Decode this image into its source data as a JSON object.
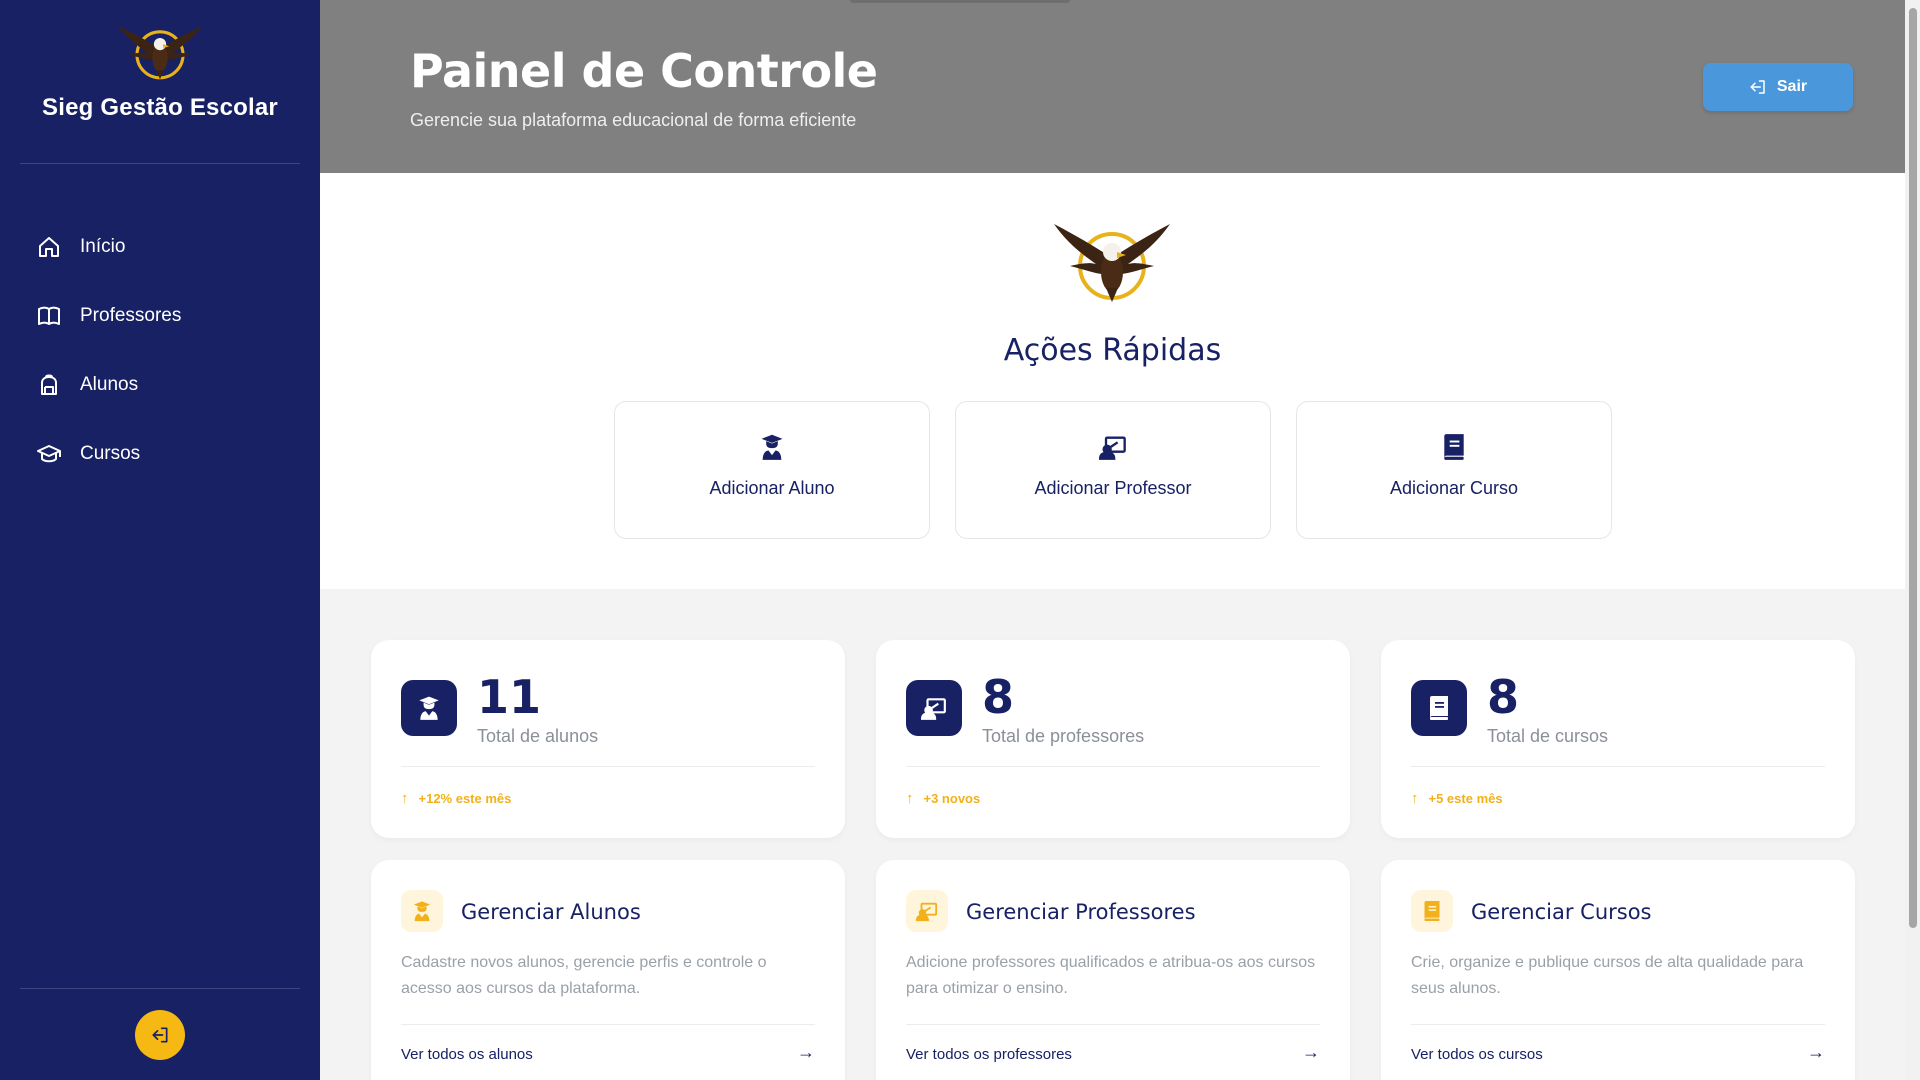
{
  "sidebar": {
    "brand_name": "Sieg Gestão Escolar",
    "items": [
      {
        "label": "Início",
        "icon": "home-icon"
      },
      {
        "label": "Professores",
        "icon": "book-icon"
      },
      {
        "label": "Alunos",
        "icon": "backpack-icon"
      },
      {
        "label": "Cursos",
        "icon": "graduation-cap-icon"
      }
    ],
    "logout_icon": "logout-icon"
  },
  "header": {
    "title": "Painel de Controle",
    "subtitle": "Gerencie sua plataforma educacional de forma eficiente",
    "logout_label": "Sair"
  },
  "quick_actions": {
    "title": "Ações Rápidas",
    "items": [
      {
        "label": "Adicionar Aluno",
        "icon": "student-icon"
      },
      {
        "label": "Adicionar Professor",
        "icon": "teacher-icon"
      },
      {
        "label": "Adicionar Curso",
        "icon": "book-icon"
      }
    ]
  },
  "stats": [
    {
      "value": "11",
      "label": "Total de alunos",
      "trend": "+12% este mês",
      "icon": "student-icon"
    },
    {
      "value": "8",
      "label": "Total de professores",
      "trend": "+3 novos",
      "icon": "teacher-icon"
    },
    {
      "value": "8",
      "label": "Total de cursos",
      "trend": "+5 este mês",
      "icon": "book-icon"
    }
  ],
  "manage": [
    {
      "title": "Gerenciar Alunos",
      "description": "Cadastre novos alunos, gerencie perfis e controle o acesso aos cursos da plataforma.",
      "link": "Ver todos os alunos"
    },
    {
      "title": "Gerenciar Professores",
      "description": "Adicione professores qualificados e atribua-os aos cursos para otimizar o ensino.",
      "link": "Ver todos os professores"
    },
    {
      "title": "Gerenciar Cursos",
      "description": "Crie, organize e publique cursos de alta qualidade para seus alunos.",
      "link": "Ver todos os cursos"
    }
  ],
  "colors": {
    "primary": "#172164",
    "accent": "#f6b913",
    "header_bg": "#808080",
    "logout_button": "#4a98db"
  }
}
